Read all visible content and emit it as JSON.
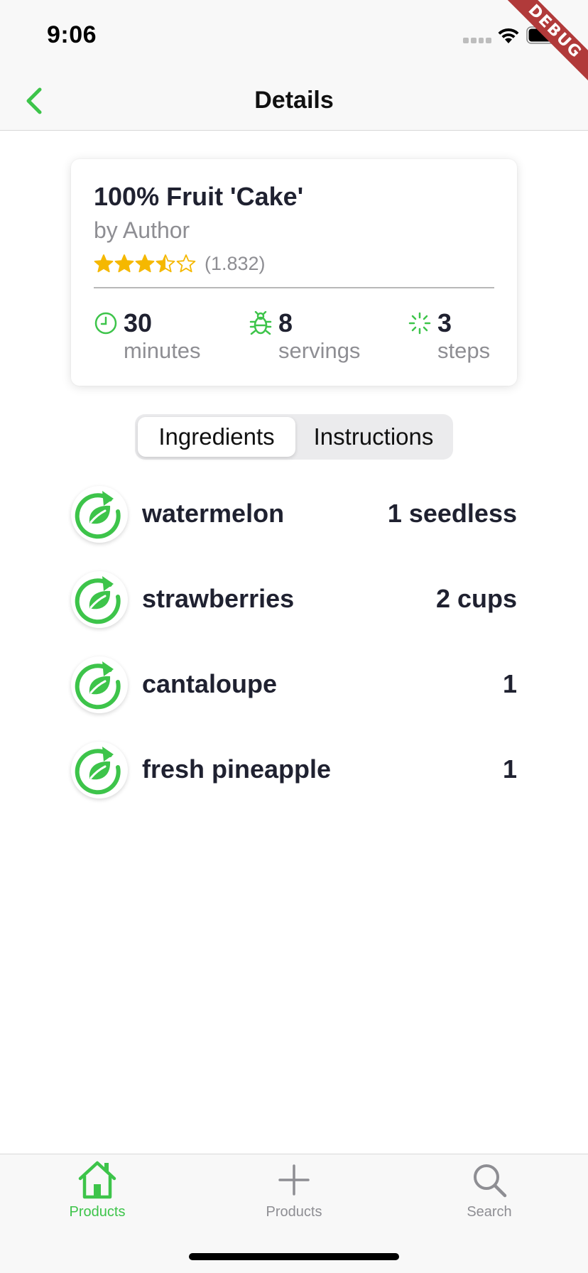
{
  "status_bar": {
    "time": "9:06",
    "debug_label": "DEBUG"
  },
  "nav": {
    "title": "Details",
    "back_icon": "chevron-left-icon"
  },
  "colors": {
    "accent": "#3dc44a",
    "star": "#f5b800",
    "text": "#1f2130",
    "muted": "#8e8e93"
  },
  "recipe": {
    "title": "100% Fruit 'Cake'",
    "author": "by Author",
    "rating": 3.5,
    "rating_max": 5,
    "rating_count": "(1.832)",
    "stats": {
      "time": {
        "value": "30",
        "label": "minutes",
        "icon": "clock-icon"
      },
      "servings": {
        "value": "8",
        "label": "servings",
        "icon": "bug-icon"
      },
      "steps": {
        "value": "3",
        "label": "steps",
        "icon": "spinner-icon"
      }
    }
  },
  "segmented": {
    "selected": "Ingredients",
    "options": [
      "Ingredients",
      "Instructions"
    ]
  },
  "ingredients": [
    {
      "name": "watermelon",
      "quantity": "1 seedless"
    },
    {
      "name": "strawberries",
      "quantity": "2 cups"
    },
    {
      "name": "cantaloupe",
      "quantity": "1"
    },
    {
      "name": "fresh pineapple",
      "quantity": "1"
    }
  ],
  "tab_bar": {
    "items": [
      {
        "label": "Products",
        "icon": "home-icon",
        "active": true
      },
      {
        "label": "Products",
        "icon": "plus-icon",
        "active": false
      },
      {
        "label": "Search",
        "icon": "search-icon",
        "active": false
      }
    ]
  }
}
